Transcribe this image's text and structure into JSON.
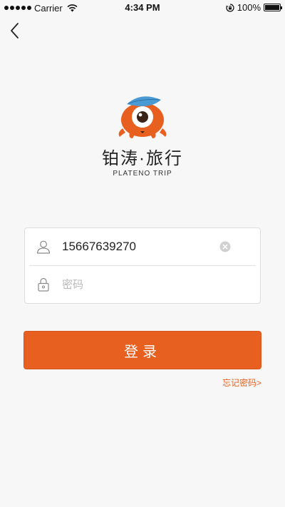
{
  "status_bar": {
    "carrier": "Carrier",
    "time": "4:34 PM",
    "battery": "100%"
  },
  "brand": {
    "name": "铂涛·旅行",
    "subtitle": "PLATENO TRIP",
    "mascot_color": "#e8601f",
    "leaf_color": "#4a9ad4"
  },
  "form": {
    "phone_value": "15667639270",
    "password_placeholder": "密码"
  },
  "actions": {
    "login_label": "登录",
    "forgot_label": "忘记密码>"
  },
  "colors": {
    "accent": "#e8601f",
    "background": "#f7f7f7"
  }
}
